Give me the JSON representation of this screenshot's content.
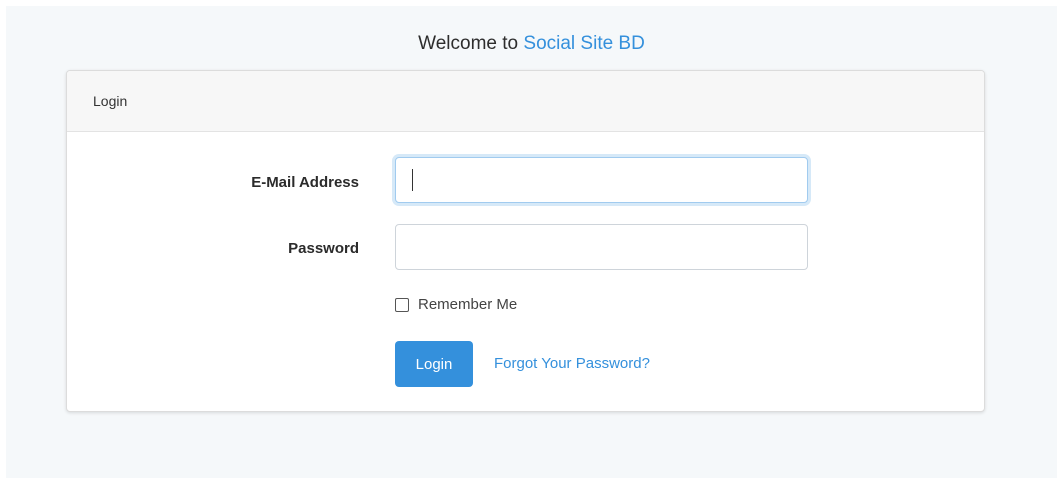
{
  "header": {
    "welcome_prefix": "Welcome to",
    "brand": "Social Site BD"
  },
  "card": {
    "title": "Login"
  },
  "form": {
    "email_label": "E-Mail Address",
    "email_value": "",
    "password_label": "Password",
    "password_value": "",
    "remember_label": "Remember Me",
    "remember_checked": false,
    "login_button": "Login",
    "forgot_link": "Forgot Your Password?"
  },
  "colors": {
    "accent": "#3490dc",
    "page_background": "#f5f8fa",
    "card_header_background": "#f7f7f7"
  }
}
